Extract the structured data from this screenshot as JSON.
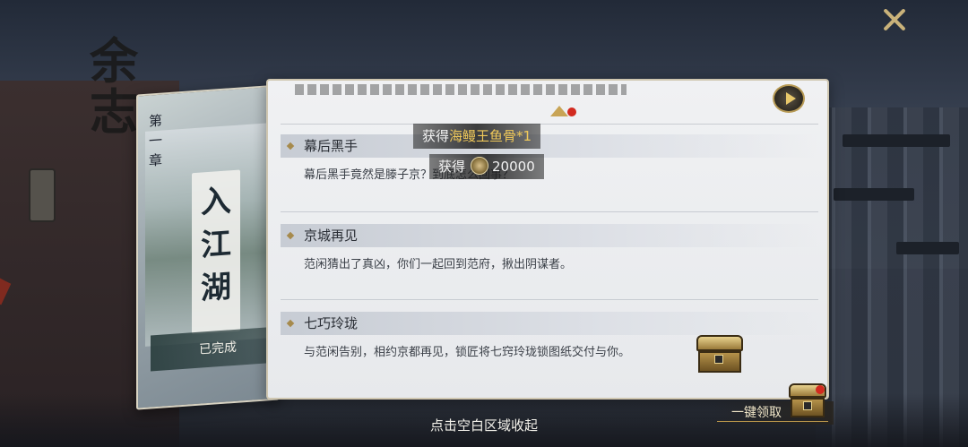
{
  "background": {
    "calligraphy": "余\n志"
  },
  "chapter": {
    "label": "第\n一\n章",
    "title": "入\n江\n湖",
    "status": "已完成"
  },
  "rewards": [
    {
      "prefix": "获得",
      "item": "海鳗王鱼骨*1"
    },
    {
      "prefix": "获得",
      "amount": "20000"
    }
  ],
  "tasks": [
    {
      "title": "幕后黑手",
      "description": "幕后黑手竟然是滕子京？到底怎么回事？"
    },
    {
      "title": "京城再见",
      "description": "范闲猜出了真凶，你们一起回到范府，揪出阴谋者。"
    },
    {
      "title": "七巧玲珑",
      "description": "与范闲告别，相约京都再见，锁匠将七窍玲珑锁图纸交付与你。"
    }
  ],
  "footer": {
    "collapse_hint": "点击空白区域收起",
    "claim_all": "一键领取"
  },
  "colors": {
    "accent_gold": "#f0c95a",
    "notification_red": "#d22a1f",
    "panel_bg": "#eceef1"
  },
  "icons": {
    "close": "close-icon",
    "play": "play-icon",
    "coin": "coin-icon",
    "chest": "treasure-chest-icon"
  }
}
